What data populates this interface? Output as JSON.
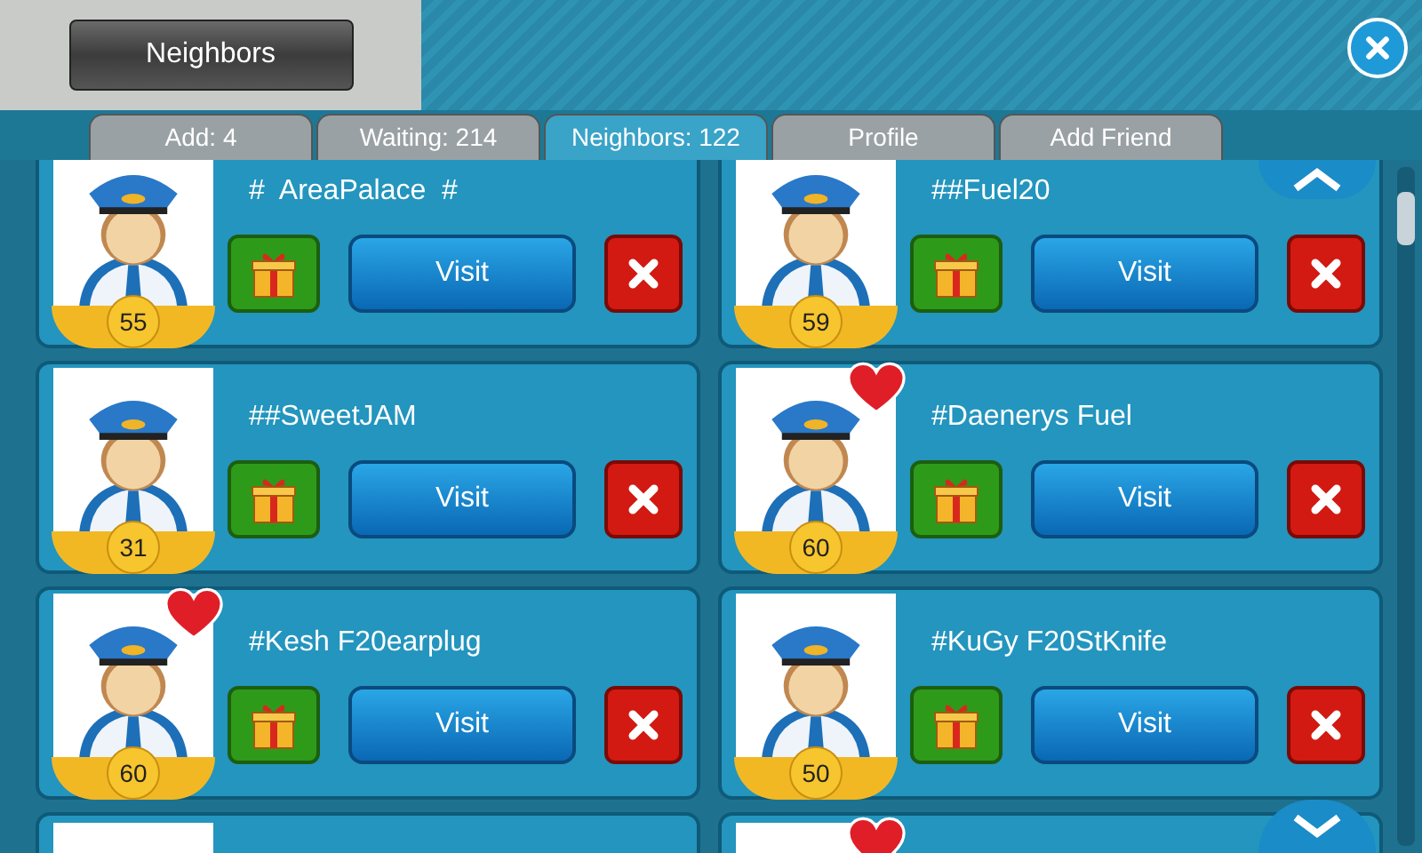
{
  "header": {
    "title": "Neighbors"
  },
  "tabs": [
    {
      "label": "Add: 4",
      "selected": false
    },
    {
      "label": "Waiting: 214",
      "selected": false
    },
    {
      "label": "Neighbors: 122",
      "selected": true
    },
    {
      "label": "Profile",
      "selected": false
    },
    {
      "label": "Add Friend",
      "selected": false
    }
  ],
  "neighbors": [
    {
      "name": "#  AreaPalace  #",
      "level": "55",
      "favorite": false,
      "visit_label": "Visit"
    },
    {
      "name": "##Fuel20",
      "level": "59",
      "favorite": false,
      "visit_label": "Visit"
    },
    {
      "name": "##SweetJAM",
      "level": "31",
      "favorite": false,
      "visit_label": "Visit"
    },
    {
      "name": "#Daenerys Fuel",
      "level": "60",
      "favorite": true,
      "visit_label": "Visit"
    },
    {
      "name": "#Kesh F20earplug",
      "level": "60",
      "favorite": true,
      "visit_label": "Visit"
    },
    {
      "name": "#KuGy F20StKnife",
      "level": "50",
      "favorite": false,
      "visit_label": "Visit"
    }
  ],
  "partial_cards": [
    {
      "favorite": false
    },
    {
      "favorite": true
    }
  ]
}
